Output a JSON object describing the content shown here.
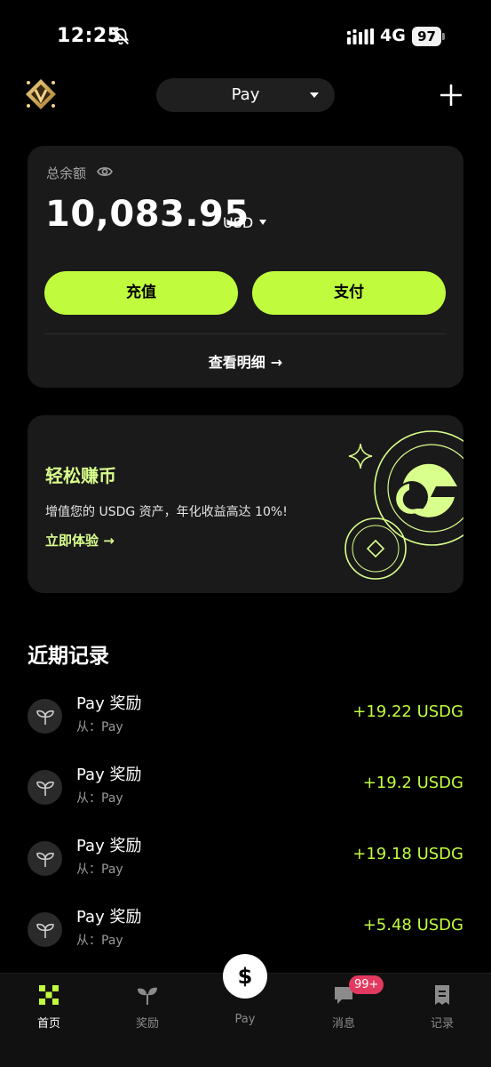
{
  "status_bar": {
    "time": "12:25",
    "network": "4G",
    "battery": "97"
  },
  "header": {
    "account_selector": "Pay"
  },
  "balance": {
    "label": "总余额",
    "amount": "10,083.95",
    "currency": "USD",
    "recharge_label": "充值",
    "pay_label": "支付",
    "details_label": "查看明细",
    "details_arrow": "→"
  },
  "promo": {
    "title": "轻松赚币",
    "description": "增值您的 USDG 资产，年化收益高达 10%!",
    "cta": "立即体验",
    "cta_arrow": "→"
  },
  "records": {
    "title": "近期记录",
    "items": [
      {
        "title": "Pay 奖励",
        "source": "从：Pay",
        "amount": "+19.22 USDG"
      },
      {
        "title": "Pay 奖励",
        "source": "从：Pay",
        "amount": "+19.2 USDG"
      },
      {
        "title": "Pay 奖励",
        "source": "从：Pay",
        "amount": "+19.18 USDG"
      },
      {
        "title": "Pay 奖励",
        "source": "从：Pay",
        "amount": "+5.48 USDG"
      }
    ]
  },
  "nav": {
    "home": "首页",
    "rewards": "奖励",
    "pay_symbol": "$",
    "pay": "Pay",
    "messages": "消息",
    "messages_badge": "99+",
    "records": "记录"
  },
  "colors": {
    "accent": "#c0fc3d",
    "card": "#1a1a1a",
    "background": "#000000",
    "badge": "#e1395f"
  }
}
